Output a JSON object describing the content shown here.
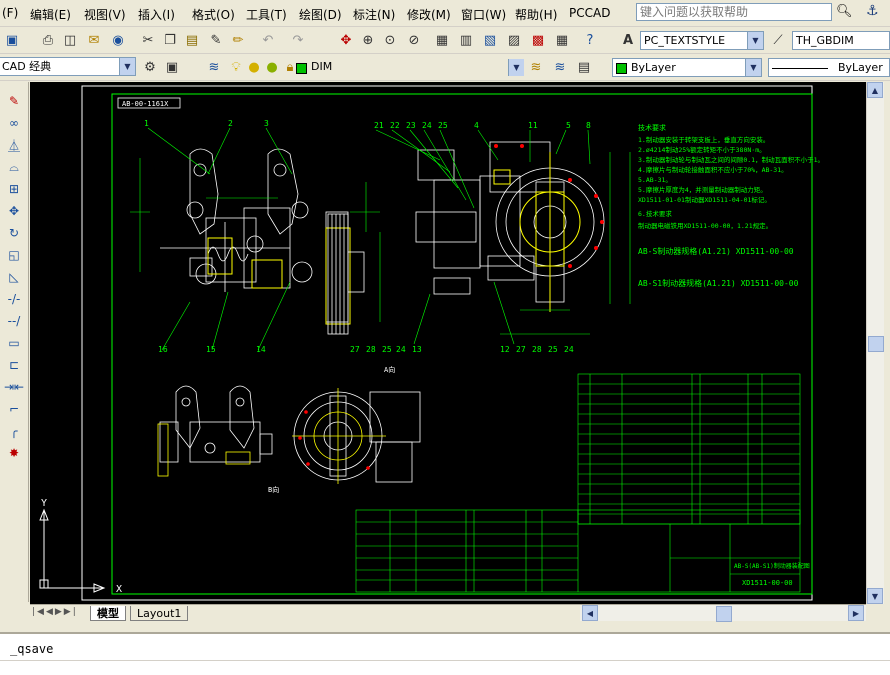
{
  "menu": {
    "items": [
      "(F)",
      "编辑(E)",
      "视图(V)",
      "插入(I)",
      "格式(O)",
      "工具(T)",
      "绘图(D)",
      "标注(N)",
      "修改(M)",
      "窗口(W)",
      "帮助(H)",
      "PCCAD"
    ],
    "search_placeholder": "键入问题以获取帮助"
  },
  "toolbar": {
    "text_style": "PC_TEXTSTYLE",
    "dim_style": "TH_GBDIM",
    "workspace": "CAD 经典",
    "layer": "DIM",
    "color": "ByLayer",
    "linetype": "ByLayer"
  },
  "tabs": [
    "模型",
    "Layout1"
  ],
  "command_line": "_qsave",
  "drawing": {
    "title_code": "AB-00-1161X",
    "section_label": "A向",
    "view_label": "B向",
    "leader_numbers_left": [
      "1",
      "2",
      "3"
    ],
    "leader_numbers_mid": [
      "21",
      "22",
      "23",
      "24",
      "25"
    ],
    "leader_numbers_right": [
      "4",
      "11",
      "5",
      "8"
    ],
    "bottom_numbers_left": [
      "16",
      "15",
      "14"
    ],
    "bottom_numbers_mid": [
      "27",
      "28",
      "25",
      "24",
      "13"
    ],
    "bottom_numbers_right": [
      "12",
      "27",
      "28",
      "25",
      "24"
    ],
    "notes_title": "技术要求",
    "notes": [
      "1.制动器安装于转架支板上，垂直方向安装。",
      "2.ø4214制动25%额定转矩不小于380N·m。",
      "3.制动器制动轮与制动瓦之间的间隙0.1，制动瓦面积不小于1。",
      "4.摩擦片与制动轮接触面积不应小于70%，AB-31。",
      "5.AB-31。",
      "5.摩擦片厚度为4，并测量制动器制动力矩。",
      "XD1511-01-01制动器XD1511-04-01标记。",
      "6.技术要求",
      "制动器电磁铁用XD1511-00-00，1.21规定。",
      "AB-S制动器XD1511-00-00",
      "AB-S1制动器(A1.21) XD1511-00-00"
    ],
    "notes_emphasis": [
      "AB-S制动器规格(A1.21) XD1511-00-00",
      "AB-S1制动器规格(A1.21) XD1511-00-00"
    ],
    "bom_code": "XD1511-00-00",
    "bom_title": "AB-S(AB-S1)制动器装配图",
    "axis_labels": {
      "y": "Y",
      "x": "X"
    }
  },
  "colors": {
    "background": "#000000",
    "geometry": "#ffffff",
    "dimension": "#00ff00",
    "highlight": "#ffff00",
    "accent_red": "#ff0000"
  }
}
